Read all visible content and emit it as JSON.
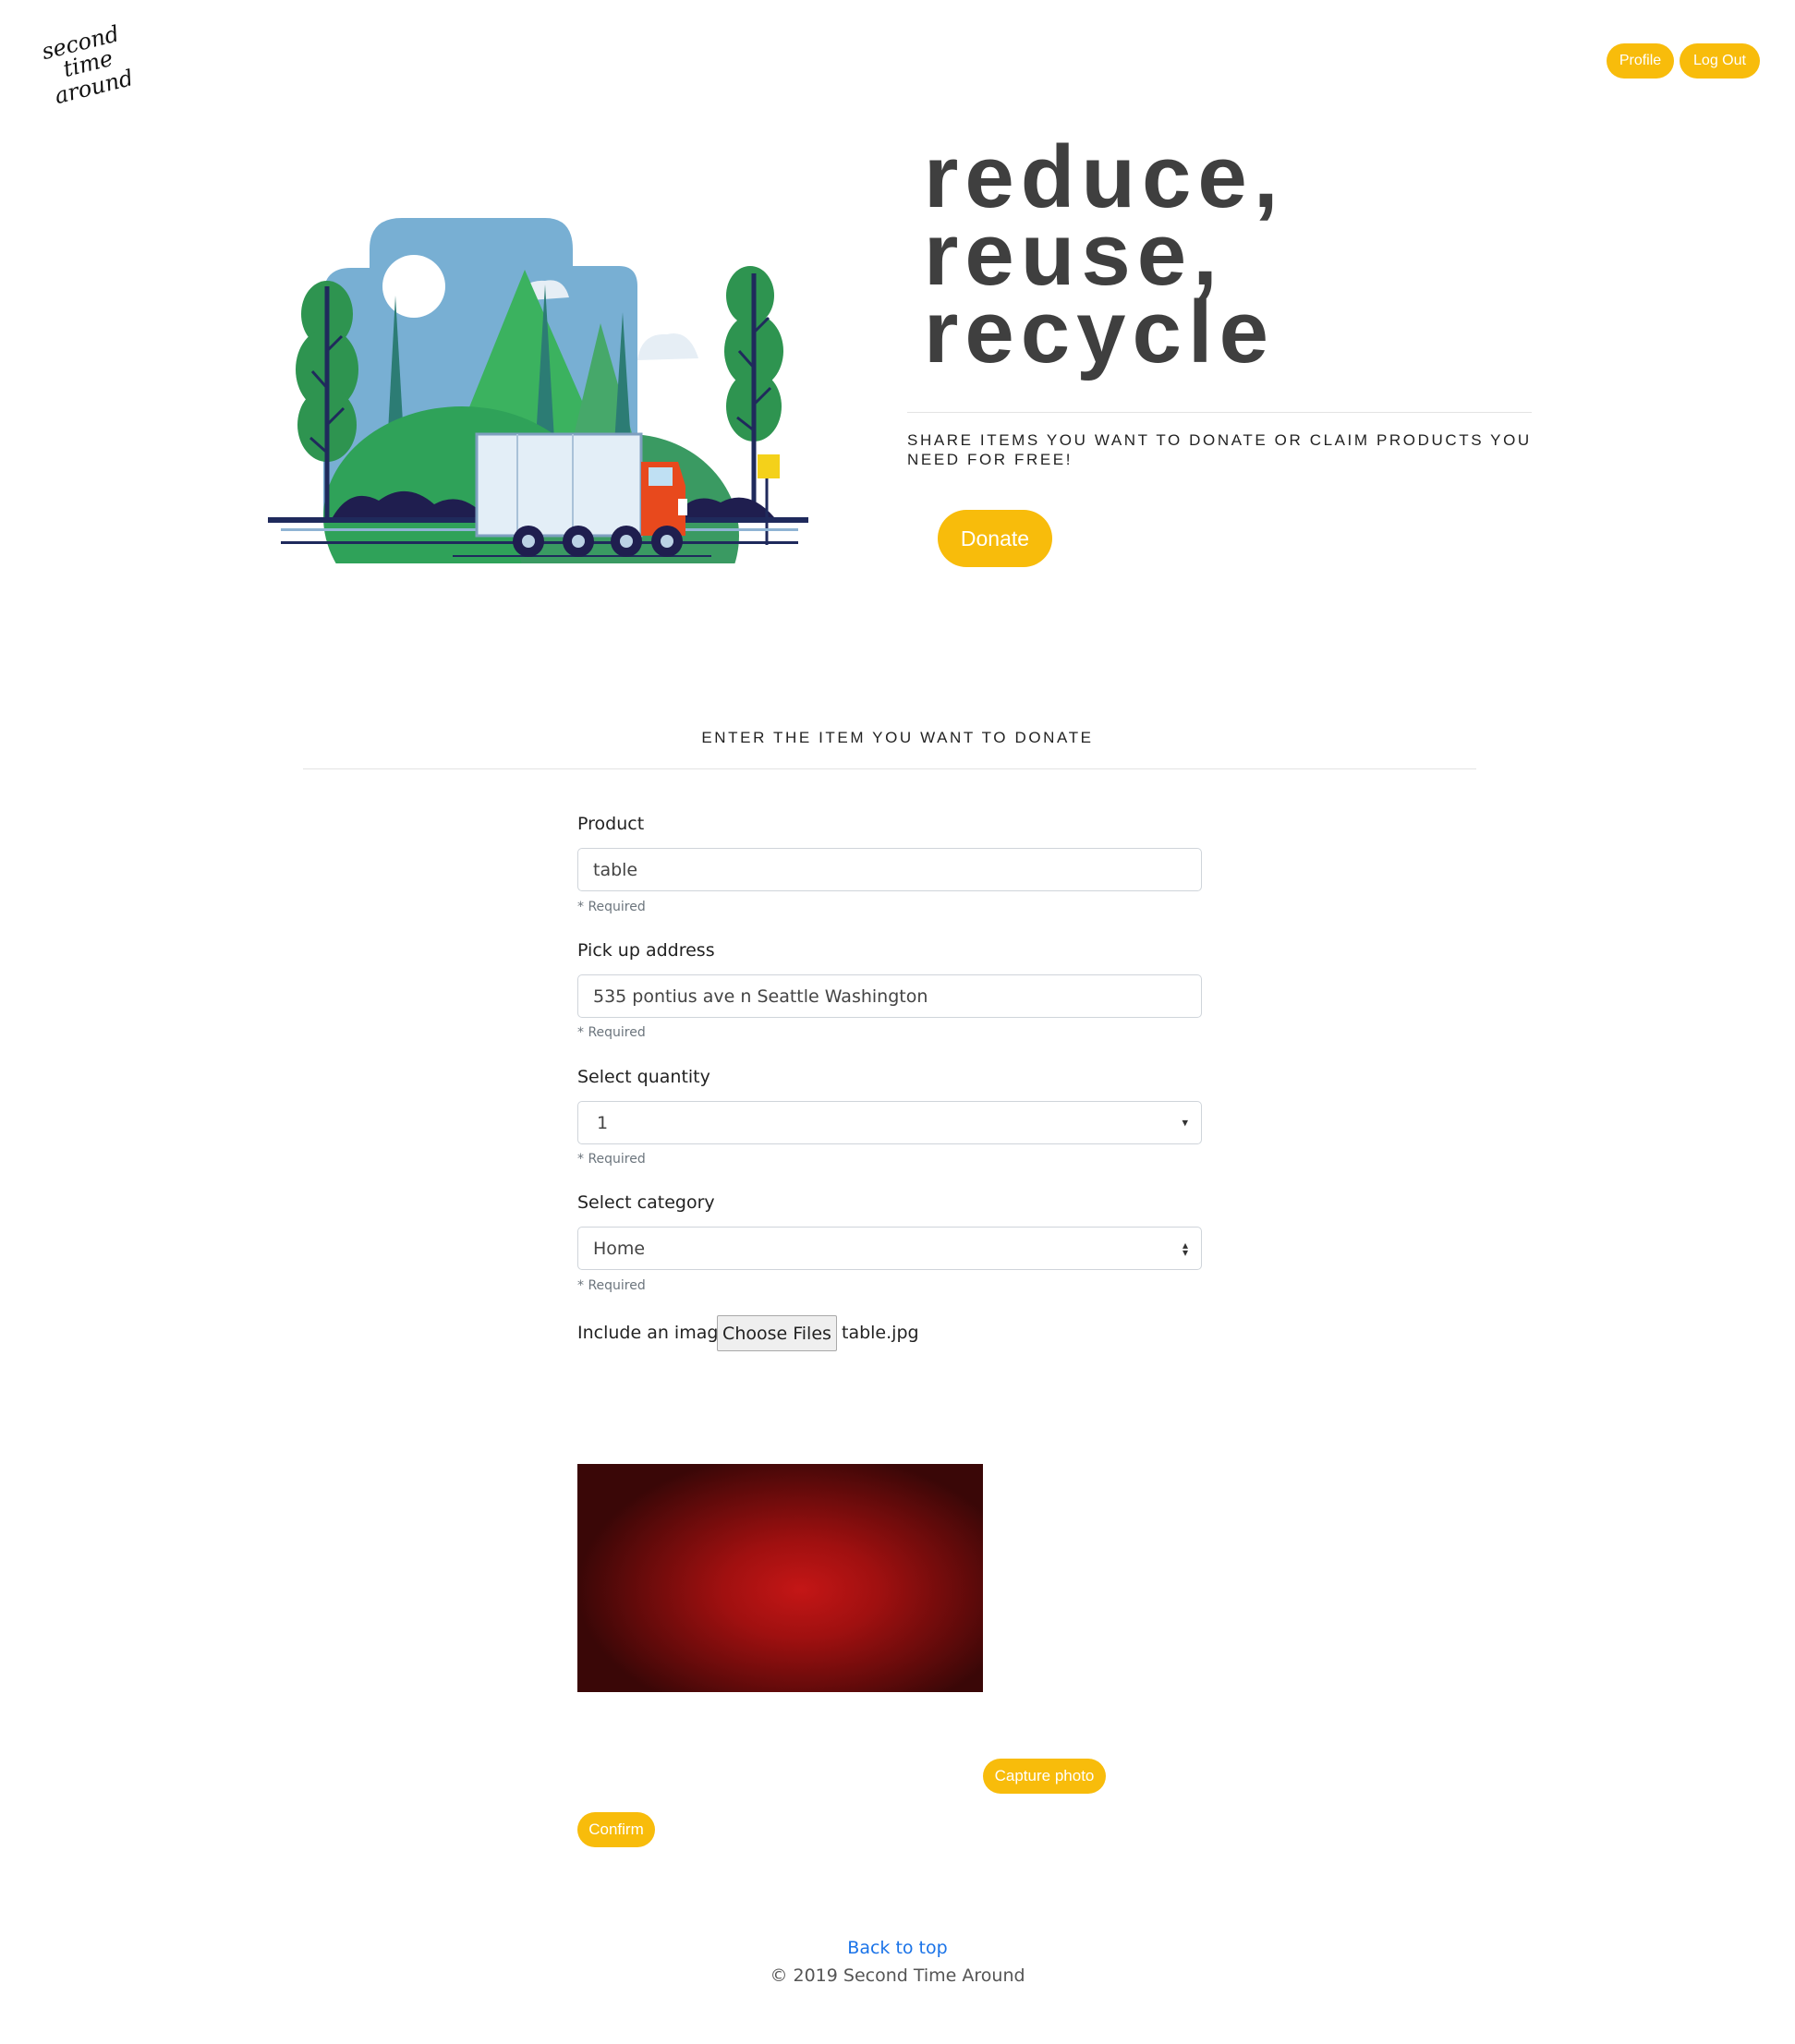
{
  "header": {
    "logo_text": [
      "second",
      "time",
      "around"
    ],
    "profile_label": "Profile",
    "logout_label": "Log Out"
  },
  "hero": {
    "headline": [
      "reduce,",
      "reuse,",
      "recycle"
    ],
    "tagline": "SHARE ITEMS YOU WANT TO DONATE OR CLAIM PRODUCTS YOU NEED FOR FREE!",
    "donate_label": "Donate"
  },
  "form": {
    "heading": "ENTER THE ITEM YOU WANT TO DONATE",
    "product": {
      "label": "Product",
      "value": "table",
      "hint": "* Required"
    },
    "address": {
      "label": "Pick up address",
      "value": "535 pontius ave n Seattle Washington",
      "hint": "* Required"
    },
    "quantity": {
      "label": "Select quantity",
      "value": "1",
      "hint": "* Required"
    },
    "category": {
      "label": "Select category",
      "value": "Home",
      "hint": "* Required"
    },
    "image": {
      "label": "Include an image",
      "button": "Choose Files",
      "file": "table.jpg"
    },
    "capture_label": "Capture photo",
    "confirm_label": "Confirm"
  },
  "footer": {
    "back_to_top": "Back to top",
    "copyright": "© 2019 Second Time Around"
  },
  "colors": {
    "accent": "#f8bc0b",
    "link": "#1a73e8",
    "headline": "#3f3f3f"
  }
}
